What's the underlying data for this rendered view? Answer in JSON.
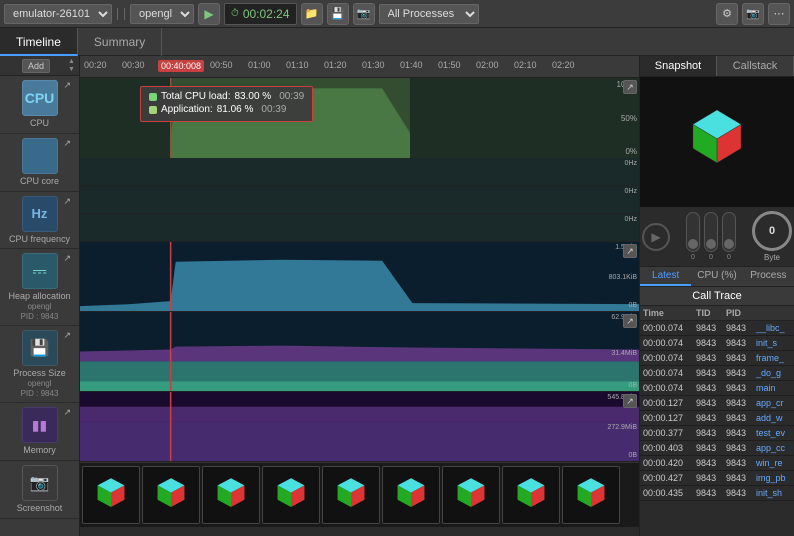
{
  "topbar": {
    "emulator_label": "emulator-26101",
    "opengl_label": "opengl",
    "timer": "00:02:24",
    "all_processes_label": "All Processes"
  },
  "tabs": {
    "timeline_label": "Timeline",
    "summary_label": "Summary"
  },
  "sidebar": {
    "add_label": "Add",
    "items": [
      {
        "id": "cpu",
        "label": "CPU",
        "icon": "cpu"
      },
      {
        "id": "cpu-core",
        "label": "CPU core",
        "icon": "cpu-core"
      },
      {
        "id": "cpu-freq",
        "label": "CPU frequency",
        "icon": "hz"
      },
      {
        "id": "heap",
        "label": "Heap allocation",
        "icon": "heap",
        "sub1": "opengl",
        "sub2": "PID : 9843"
      },
      {
        "id": "process-size",
        "label": "Process Size",
        "icon": "process",
        "sub1": "opengl",
        "sub2": "PID : 9843"
      },
      {
        "id": "memory",
        "label": "Memory",
        "icon": "memory"
      },
      {
        "id": "screenshot",
        "label": "Screenshot",
        "icon": "screenshot"
      }
    ]
  },
  "time_ruler": {
    "ticks": [
      "00:20",
      "00:30",
      "00:40:008",
      "00:50",
      "01:00",
      "01:10",
      "01:20",
      "01:30",
      "01:40",
      "01:50",
      "02:00",
      "02:10",
      "02:20"
    ],
    "active_tick": "00:40:008"
  },
  "cpu_chart": {
    "tooltip": {
      "total_cpu_label": "Total CPU load:",
      "total_cpu_value": "83.00 %",
      "total_cpu_time": "00:39",
      "app_label": "Application:",
      "app_value": "81.06 %",
      "app_time": "00:39"
    },
    "y_labels": [
      "100%",
      "50%",
      "0%"
    ],
    "y_labels2": [
      "0Hz",
      "0Hz",
      "0Hz"
    ]
  },
  "heap_chart": {
    "y_labels": [
      "1.5MiB",
      "803.1KiB",
      "0B"
    ]
  },
  "process_chart": {
    "y_labels": [
      "62.9MiB",
      "31.4MiB",
      "0B"
    ]
  },
  "memory_chart": {
    "y_labels": [
      "545.8MiB",
      "272.9MiB",
      "0B"
    ]
  },
  "right_panel": {
    "snapshot_tab": "Snapshot",
    "callstack_tab": "Callstack",
    "byte_label": "Byte",
    "byte_value": "0",
    "bottom_tabs": [
      "Latest",
      "CPU (%)",
      "Process"
    ],
    "call_trace_title": "Call Trace",
    "call_trace_headers": [
      "Time",
      "TID",
      "PID",
      ""
    ],
    "call_trace_rows": [
      {
        "time": "00:00.074",
        "tid": "9843",
        "pid": "9843",
        "func": "__libc_"
      },
      {
        "time": "00:00.074",
        "tid": "9843",
        "pid": "9843",
        "func": "init_s"
      },
      {
        "time": "00:00.074",
        "tid": "9843",
        "pid": "9843",
        "func": "frame_"
      },
      {
        "time": "00:00.074",
        "tid": "9843",
        "pid": "9843",
        "func": "_do_g"
      },
      {
        "time": "00:00.074",
        "tid": "9843",
        "pid": "9843",
        "func": "main"
      },
      {
        "time": "00:00.127",
        "tid": "9843",
        "pid": "9843",
        "func": "app_cr"
      },
      {
        "time": "00:00.127",
        "tid": "9843",
        "pid": "9843",
        "func": "add_w"
      },
      {
        "time": "00:00.377",
        "tid": "9843",
        "pid": "9843",
        "func": "test_ev"
      },
      {
        "time": "00:00.403",
        "tid": "9843",
        "pid": "9843",
        "func": "app_cc"
      },
      {
        "time": "00:00.420",
        "tid": "9843",
        "pid": "9843",
        "func": "win_re"
      },
      {
        "time": "00:00.427",
        "tid": "9843",
        "pid": "9843",
        "func": "img_pb"
      },
      {
        "time": "00:00.435",
        "tid": "9843",
        "pid": "9843",
        "func": "init_sh"
      }
    ]
  },
  "colors": {
    "accent_blue": "#4a9eff",
    "accent_red": "#c84040",
    "cpu_fill": "#5a9a7a",
    "app_fill": "#8fbc5a",
    "heap_fill": "#3a8aaa",
    "process_fill_teal": "#3aaa8a",
    "process_fill_purple": "#6a3a8a",
    "memory_fill": "#5a3a8a",
    "highlight": "rgba(100,120,60,0.4)"
  }
}
